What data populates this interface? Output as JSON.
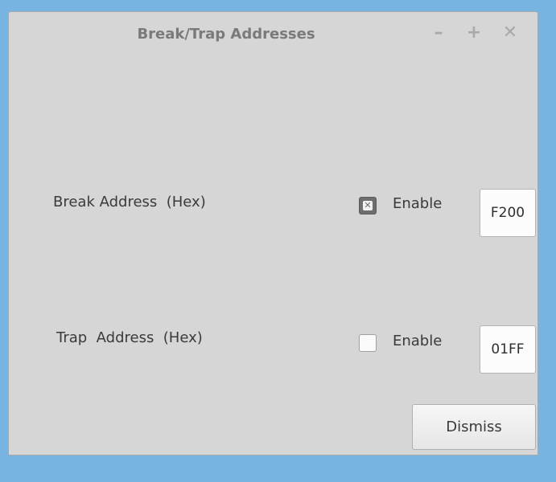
{
  "window": {
    "title": "Break/Trap Addresses",
    "controls": {
      "minimize": "–",
      "maximize": "+",
      "close": "✕"
    }
  },
  "break_row": {
    "label": "Break Address  (Hex)",
    "enable_label": "Enable",
    "enabled": true,
    "value": "F200"
  },
  "trap_row": {
    "label": "Trap  Address  (Hex)",
    "enable_label": "Enable",
    "enabled": false,
    "value": "01FF"
  },
  "dismiss_label": "Dismiss"
}
